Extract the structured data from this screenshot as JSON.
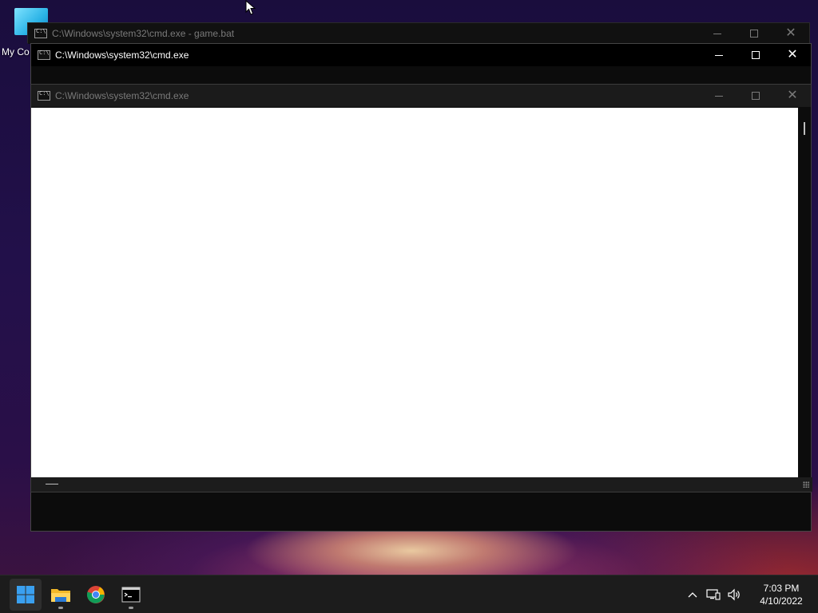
{
  "desktop": {
    "icons": [
      {
        "label": "My Co"
      }
    ]
  },
  "windows": [
    {
      "title": "C:\\Windows\\system32\\cmd.exe - game.bat",
      "state": "inactive"
    },
    {
      "title": "C:\\Windows\\system32\\cmd.exe",
      "state": "active"
    },
    {
      "title": "C:\\Windows\\system32\\cmd.exe",
      "state": "inactive"
    }
  ],
  "window_controls": {
    "minimize": "minimize-icon",
    "maximize": "maximize-icon",
    "close": "close-icon"
  },
  "taskbar": {
    "apps": [
      {
        "name": "start-icon"
      },
      {
        "name": "file-explorer-icon"
      },
      {
        "name": "chrome-icon"
      },
      {
        "name": "cmd-icon"
      }
    ],
    "tray": {
      "icons": [
        "chevron-up-icon",
        "network-icon",
        "volume-icon"
      ],
      "time": "7:03 PM",
      "date": "4/10/2022"
    }
  },
  "colors": {
    "accent": "#0078d4",
    "taskbar_bg": "#1c1c1c",
    "console_bg": "#0c0c0c",
    "client_bg": "#ffffff"
  }
}
